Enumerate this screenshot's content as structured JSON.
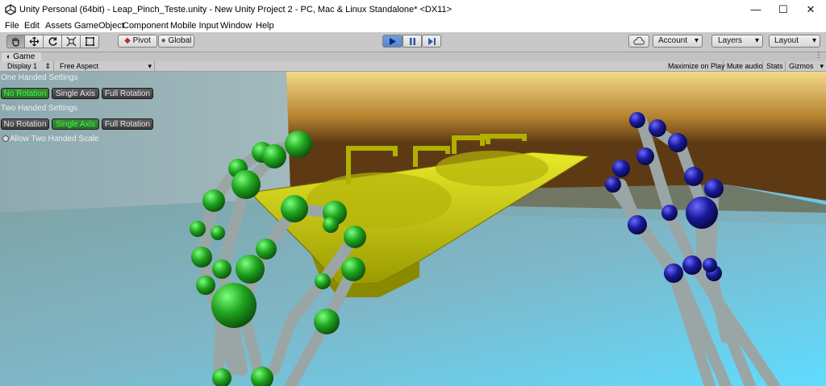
{
  "window": {
    "title": "Unity Personal (64bit) - Leap_Pinch_Teste.unity - New Unity Project 2 - PC, Mac & Linux Standalone* <DX11>",
    "minimize": "—",
    "maximize": "☐",
    "close": "✕"
  },
  "menu": [
    "File",
    "Edit",
    "Assets",
    "GameObject",
    "Component",
    "Mobile Input",
    "Window",
    "Help"
  ],
  "toolbar": {
    "pivot": "Pivot",
    "global": "Global",
    "account": "Account",
    "layers": "Layers",
    "layout": "Layout",
    "dropdown_arrow": "▾"
  },
  "game_panel": {
    "tab": "Game",
    "display": "Display 1",
    "aspect": "Free Aspect",
    "maximize_on_play": "Maximize on Play",
    "mute_audio": "Mute audio",
    "stats": "Stats",
    "gizmos": "Gizmos"
  },
  "settings": {
    "one_handed_heading": "One Handed Settings",
    "two_handed_heading": "Two Handed Settings",
    "no_rotation": "No Rotation",
    "single_axis": "Single Axis",
    "full_rotation": "Full Rotation",
    "allow_two_handed_scale": "Allow Two Handed Scale"
  },
  "colors": {
    "active_green": "#3cff3c",
    "left_hand_joints": "#1fa51f",
    "right_hand_joints": "#1a1a9c",
    "sink": "#c8c800"
  }
}
